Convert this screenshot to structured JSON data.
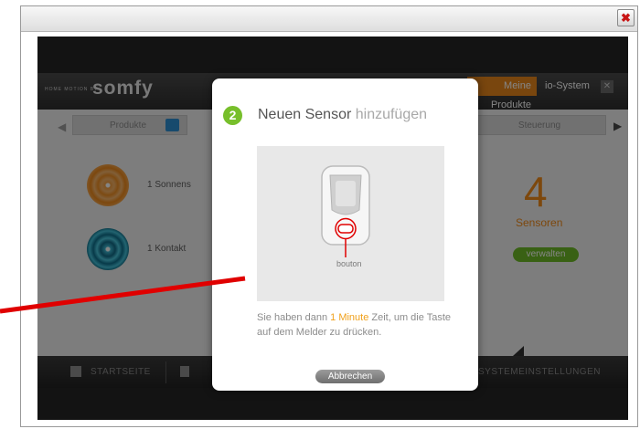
{
  "window": {
    "close_label": "✖"
  },
  "header": {
    "tagline": "HOME MOTION BY",
    "logo": "somfy",
    "my_products": "Meine Produkte",
    "io_system": "io-System",
    "close": "✕"
  },
  "tabs": {
    "left_arrow": "◀",
    "produkte": "Produkte",
    "steuerung": "Steuerung",
    "right_arrow": "▶"
  },
  "sensors": {
    "row1": "1 Sonnens",
    "row2": "1 Kontakt",
    "count": "4",
    "count_label": "Sensoren",
    "manage_button": "verwalten"
  },
  "bottom_nav": {
    "start": "STARTSEITE",
    "system": "SYSTEMEINSTELLUNGEN"
  },
  "modal": {
    "step": "2",
    "title_main": "Neuen Sensor ",
    "title_highlight": "hinzufügen",
    "button_caption": "bouton",
    "desc_before": "Sie haben dann ",
    "desc_highlight": "1 Minute",
    "desc_after": " Zeit, um die Taste auf dem Melder zu drücken.",
    "cancel": "Abbrechen"
  },
  "colors": {
    "accent_orange": "#ef8a1a",
    "accent_green": "#77bf2b",
    "annotation_red": "#e00000"
  },
  "icons": [
    "close-icon",
    "home-icon",
    "products-icon",
    "sensor-device-icon",
    "arrow-annotation"
  ]
}
